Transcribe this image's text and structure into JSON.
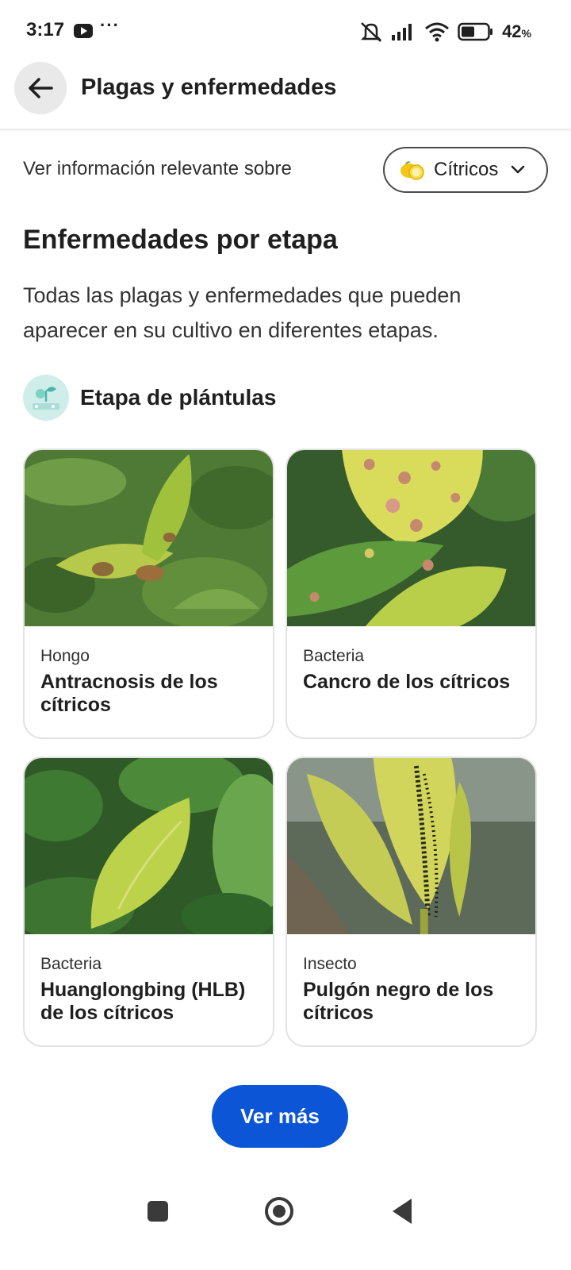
{
  "status_bar": {
    "time": "3:17",
    "battery": "42",
    "battery_unit": "%",
    "icons": [
      "youtube-icon",
      "more-dots-icon",
      "mute-icon",
      "signal-icon",
      "wifi-icon",
      "battery-icon"
    ]
  },
  "app_bar": {
    "title": "Plagas y enfermedades",
    "back_icon": "arrow-left-icon"
  },
  "crop_filter": {
    "label": "Ver información relevante sobre",
    "selected": "Cítricos",
    "icon": "lemon-icon"
  },
  "section": {
    "title": "Enfermedades por etapa",
    "description": "Todas las plagas y enfermedades que pueden aparecer en su cultivo en diferentes etapas."
  },
  "stage": {
    "label": "Etapa de plántulas",
    "icon": "seedling-stage-icon"
  },
  "cards": [
    {
      "type": "Hongo",
      "name": "Antracnosis de los cítricos"
    },
    {
      "type": "Bacteria",
      "name": "Cancro de los cítricos"
    },
    {
      "type": "Bacteria",
      "name": "Huanglongbing (HLB) de los cítricos"
    },
    {
      "type": "Insecto",
      "name": "Pulgón negro de los cítricos"
    }
  ],
  "more_button": "Ver más",
  "colors": {
    "accent": "#0b55d6",
    "text": "#1f1f1f",
    "stage_icon_bg": "#cfeeea"
  }
}
